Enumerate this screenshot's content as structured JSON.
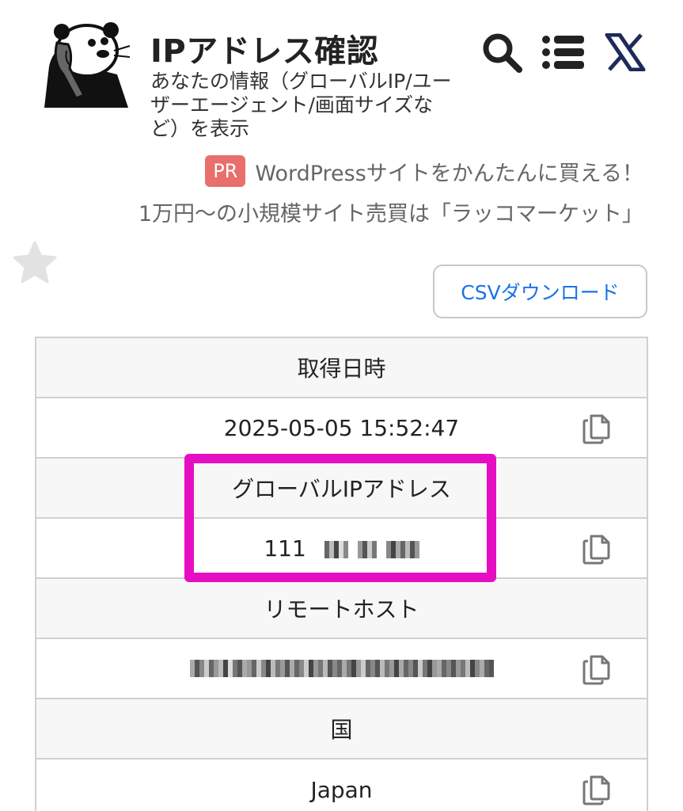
{
  "header": {
    "site_title": "IPアドレス確認",
    "site_description": "あなたの情報（グローバルIP/ユーザーエージェント/画面サイズなど）を表示",
    "icons": [
      "search-icon",
      "menu-icon",
      "x-logo-icon"
    ]
  },
  "promo": {
    "badge": "PR",
    "line1": "WordPressサイトをかんたんに買える！",
    "line2": "1万円〜の小規模サイト売買は「ラッコマーケット」"
  },
  "actions": {
    "csv_download": "CSVダウンロード"
  },
  "table": {
    "rows": [
      {
        "label": "取得日時",
        "value": "2025-05-05 15:52:47"
      },
      {
        "label": "グローバルIPアドレス",
        "value_prefix": "111"
      },
      {
        "label": "リモートホスト"
      },
      {
        "label": "国",
        "value": "Japan"
      }
    ]
  },
  "colors": {
    "accent_link": "#1a73e8",
    "pr_badge": "#e86f6b",
    "highlight": "#e60ec2",
    "header_row_bg": "#f7f7f7",
    "border": "#d0d0d0"
  }
}
